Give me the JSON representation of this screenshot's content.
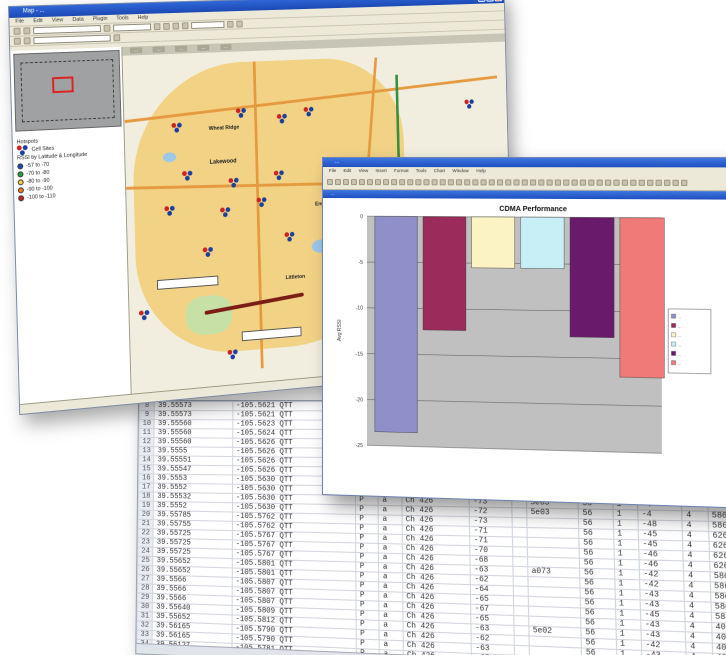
{
  "map_window": {
    "title": "Map - ...",
    "menus": [
      "File",
      "Edit",
      "View",
      "Data",
      "Plugin",
      "Tools",
      "Help"
    ],
    "tabs": [
      "...",
      "...",
      "...",
      "...",
      "..."
    ],
    "place_labels": [
      "Lakewood",
      "Wheat Ridge",
      "Littleton",
      "Englewood"
    ],
    "legend_items": [
      {
        "label": "-57 to -70",
        "color": "#2048b8"
      },
      {
        "label": "-70 to -80",
        "color": "#29a046"
      },
      {
        "label": "-80 to -90",
        "color": "#f3d23a"
      },
      {
        "label": "-90 to -100",
        "color": "#ef7b1c"
      },
      {
        "label": "-100 to -110",
        "color": "#c52121"
      }
    ],
    "layers_heading": "Hotspots",
    "layer_name": "Cell Sites",
    "range_heading": "RSSI by Latitude & Longitude"
  },
  "chart_window": {
    "title": "...",
    "menus": [
      "File",
      "Edit",
      "View",
      "Insert",
      "Format",
      "Tools",
      "Chart",
      "Window",
      "Help"
    ],
    "subtitle": "..."
  },
  "chart_data": {
    "type": "bar",
    "title": "CDMA Performance",
    "ylabel": "Avg RSSI",
    "ylim": [
      -25,
      0
    ],
    "yticks": [
      0,
      -5,
      -10,
      -15,
      -20,
      -25
    ],
    "series": [
      {
        "value": -23.5,
        "color": "#8f8fc9"
      },
      {
        "value": -12.3,
        "color": "#9a2b5a"
      },
      {
        "value": -5.5,
        "color": "#fbf3c4"
      },
      {
        "value": -5.5,
        "color": "#c8eef6"
      },
      {
        "value": -12.8,
        "color": "#6a1a6a"
      },
      {
        "value": -17.0,
        "color": "#f07a78"
      }
    ],
    "legend_entries": [
      "...",
      "...",
      "...",
      "...",
      "...",
      "..."
    ],
    "grid": true,
    "plot_background": "#c0c0c0"
  },
  "sheet_window": {
    "rows": [
      [
        "8",
        "39.55573",
        "-105.5621 QTT",
        "P",
        "a",
        "",
        "",
        "",
        "",
        "",
        "",
        "",
        "",
        ""
      ],
      [
        "9",
        "39.55573",
        "-105.5621 QTT",
        "P",
        "a",
        "",
        "",
        "",
        "",
        "",
        "",
        "",
        "",
        ""
      ],
      [
        "10",
        "39.55560",
        "-105.5623 QTT",
        "P",
        "a",
        "",
        "",
        "",
        "",
        "",
        "",
        "",
        "",
        ""
      ],
      [
        "11",
        "39.55560",
        "-105.5624 QTT",
        "P",
        "a",
        "",
        "",
        "",
        "",
        "",
        "",
        "",
        "",
        ""
      ],
      [
        "12",
        "39.55560",
        "-105.5626 QTT",
        "P",
        "a",
        "",
        "",
        "",
        "",
        "",
        "",
        "",
        "",
        ""
      ],
      [
        "13",
        "39.5555",
        "-105.5626 QTT",
        "P",
        "a",
        "",
        "",
        "",
        "",
        "",
        "",
        "",
        "",
        ""
      ],
      [
        "14",
        "39.55551",
        "-105.5626 QTT",
        "P",
        "a",
        "",
        "",
        "",
        "",
        "",
        "",
        "",
        "",
        ""
      ],
      [
        "15",
        "39.55547",
        "-105.5626 QTT",
        "P",
        "a",
        "",
        "",
        "",
        "",
        "",
        "",
        "",
        "",
        ""
      ],
      [
        "16",
        "39.5553",
        "-105.5630 QTT",
        "P",
        "a",
        "",
        "",
        "",
        "",
        "",
        "",
        "",
        "",
        ""
      ],
      [
        "17",
        "39.5552",
        "-105.5630 QTT",
        "P",
        "a",
        "",
        "",
        "",
        "",
        "",
        "",
        "",
        "",
        ""
      ],
      [
        "18",
        "39.55532",
        "-105.5630 QTT",
        "P",
        "a",
        "Ch 426",
        "-73",
        "",
        "5e03",
        "56",
        "1",
        "-4",
        "4",
        "586"
      ],
      [
        "19",
        "39.5552",
        "-105.5630 QTT",
        "P",
        "a",
        "Ch 426",
        "-72",
        "",
        "5e03",
        "56",
        "1",
        "-4",
        "4",
        "586"
      ],
      [
        "20",
        "39.55785",
        "-105.5762 QTT",
        "P",
        "a",
        "Ch 426",
        "-73",
        "",
        "",
        "56",
        "1",
        "-48",
        "4",
        "586"
      ],
      [
        "21",
        "39.55755",
        "-105.5762 QTT",
        "P",
        "a",
        "Ch 426",
        "-71",
        "",
        "",
        "56",
        "1",
        "-45",
        "4",
        "626"
      ],
      [
        "22",
        "39.55725",
        "-105.5767 QTT",
        "P",
        "a",
        "Ch 426",
        "-71",
        "",
        "",
        "56",
        "1",
        "-45",
        "4",
        "626"
      ],
      [
        "23",
        "39.55725",
        "-105.5767 QTT",
        "P",
        "a",
        "Ch 426",
        "-70",
        "",
        "",
        "56",
        "1",
        "-46",
        "4",
        "626"
      ],
      [
        "24",
        "39.55725",
        "-105.5767 QTT",
        "P",
        "a",
        "Ch 426",
        "-68",
        "",
        "",
        "56",
        "1",
        "-46",
        "4",
        "626"
      ],
      [
        "25",
        "39.55652",
        "-105.5801 QTT",
        "P",
        "a",
        "Ch 426",
        "-63",
        "",
        "a073",
        "56",
        "1",
        "-42",
        "4",
        "586"
      ],
      [
        "26",
        "39.55652",
        "-105.5801 QTT",
        "P",
        "a",
        "Ch 426",
        "-62",
        "",
        "",
        "56",
        "1",
        "-42",
        "4",
        "586"
      ],
      [
        "27",
        "39.5566",
        "-105.5807 QTT",
        "P",
        "a",
        "Ch 426",
        "-64",
        "",
        "",
        "56",
        "1",
        "-43",
        "4",
        "586"
      ],
      [
        "28",
        "39.5566",
        "-105.5807 QTT",
        "P",
        "a",
        "Ch 426",
        "-65",
        "",
        "",
        "56",
        "1",
        "-43",
        "4",
        "586"
      ],
      [
        "29",
        "39.5566",
        "-105.5807 QTT",
        "P",
        "a",
        "Ch 426",
        "-67",
        "",
        "",
        "56",
        "1",
        "-45",
        "4",
        "586"
      ],
      [
        "30",
        "39.55640",
        "-105.5809 QTT",
        "P",
        "a",
        "Ch 426",
        "-65",
        "",
        "",
        "56",
        "1",
        "-43",
        "4",
        "404"
      ],
      [
        "31",
        "39.55652",
        "-105.5812 QTT",
        "P",
        "a",
        "Ch 426",
        "-63",
        "",
        "5e02",
        "56",
        "1",
        "-43",
        "4",
        "404"
      ],
      [
        "32",
        "39.56165",
        "-105.5790 QTT",
        "P",
        "a",
        "Ch 426",
        "-62",
        "",
        "",
        "56",
        "1",
        "-42",
        "4",
        "404"
      ],
      [
        "33",
        "39.56165",
        "-105.5790 QTT",
        "P",
        "a",
        "Ch 426",
        "-63",
        "",
        "",
        "56",
        "1",
        "-43",
        "4",
        "404"
      ],
      [
        "34",
        "39.56127",
        "-105.5781 QTT",
        "P",
        "a",
        "Ch 426",
        "-65",
        "",
        "a073",
        "56",
        "1",
        "-46",
        "4",
        "404"
      ]
    ]
  }
}
